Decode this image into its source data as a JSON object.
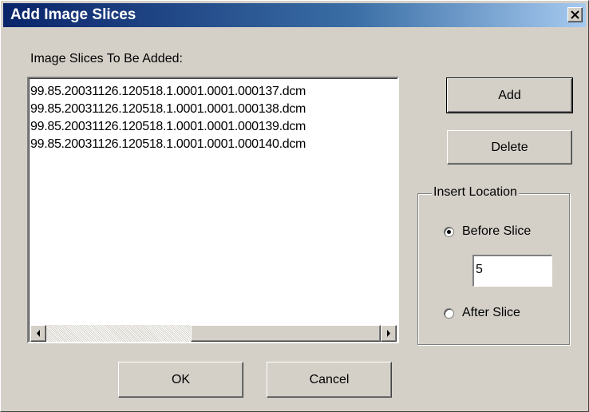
{
  "window": {
    "title": "Add Image Slices",
    "close_icon": "close-icon"
  },
  "list_label": "Image Slices To Be Added:",
  "list": {
    "items": [
      "99.85.20031126.120518.1.0001.0001.000137.dcm",
      "99.85.20031126.120518.1.0001.0001.000138.dcm",
      "99.85.20031126.120518.1.0001.0001.000139.dcm",
      "99.85.20031126.120518.1.0001.0001.000140.dcm"
    ]
  },
  "buttons": {
    "add": "Add",
    "delete": "Delete",
    "ok": "OK",
    "cancel": "Cancel"
  },
  "insert_location": {
    "legend": "Insert Location",
    "before_label": "Before Slice",
    "after_label": "After Slice",
    "selected": "before",
    "slice_value": "5"
  },
  "colors": {
    "title_start": "#0a246a",
    "title_end": "#a6caf0",
    "face": "#d4d0c8"
  }
}
